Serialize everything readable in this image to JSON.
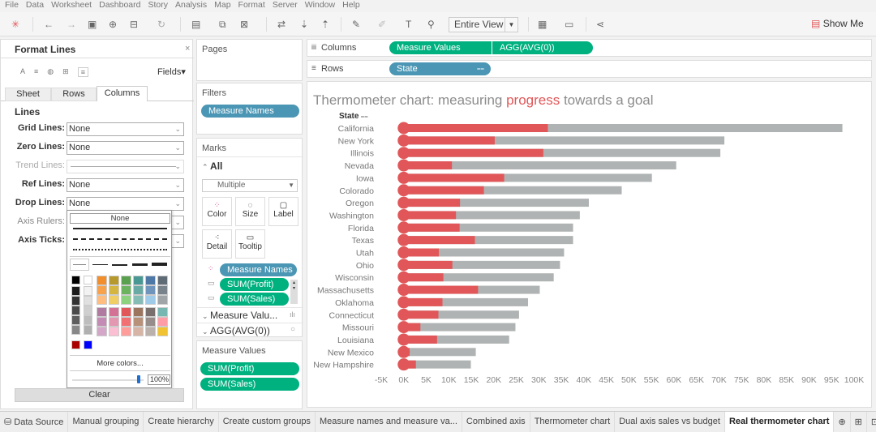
{
  "menu": [
    "File",
    "Data",
    "Worksheet",
    "Dashboard",
    "Story",
    "Analysis",
    "Map",
    "Format",
    "Server",
    "Window",
    "Help"
  ],
  "toolbar": {
    "view_select": "Entire View",
    "show_me": "Show Me"
  },
  "format_panel": {
    "title": "Format Lines",
    "close": "×",
    "fields": "Fields",
    "tabs": [
      "Sheet",
      "Rows",
      "Columns"
    ],
    "active_tab": "Columns",
    "section": "Lines",
    "rows": [
      {
        "label": "Grid Lines:",
        "value": "None"
      },
      {
        "label": "Zero Lines:",
        "value": "None"
      },
      {
        "label": "Trend Lines:",
        "value": ""
      },
      {
        "label": "Ref Lines:",
        "value": "None"
      },
      {
        "label": "Drop Lines:",
        "value": "None"
      },
      {
        "label": "Axis Rulers:",
        "value": ""
      },
      {
        "label": "Axis Ticks:",
        "value": ""
      }
    ],
    "popup": {
      "none": "None",
      "more_colors": "More colors...",
      "opacity": "100%",
      "opacity_value": 100
    },
    "clear": "Clear"
  },
  "pages": {
    "title": "Pages"
  },
  "filters": {
    "title": "Filters",
    "pills": [
      "Measure Names"
    ]
  },
  "marks": {
    "title": "Marks",
    "all": "All",
    "type": "Multiple",
    "cards": [
      "Color",
      "Size",
      "Label",
      "Detail",
      "Tooltip"
    ],
    "pills": [
      "Measure Names",
      "SUM(Profit)",
      "SUM(Sales)"
    ],
    "sections": [
      "Measure Valu...",
      "AGG(AVG(0))"
    ]
  },
  "measure_values": {
    "title": "Measure Values",
    "pills": [
      "SUM(Profit)",
      "SUM(Sales)"
    ]
  },
  "shelves": {
    "columns_label": "Columns",
    "columns": [
      "Measure Values",
      "AGG(AVG(0))"
    ],
    "rows_label": "Rows",
    "rows": [
      "State"
    ]
  },
  "chart_data": {
    "type": "bar",
    "title_parts": [
      "Thermometer chart: measuring ",
      "progress",
      " towards a goal"
    ],
    "ylabel": "State",
    "xlim": [
      -5000,
      100000
    ],
    "xticks": [
      "-5K",
      "0K",
      "5K",
      "10K",
      "15K",
      "20K",
      "25K",
      "30K",
      "35K",
      "40K",
      "45K",
      "50K",
      "55K",
      "60K",
      "65K",
      "70K",
      "75K",
      "80K",
      "85K",
      "90K",
      "95K",
      "100K"
    ],
    "categories": [
      "California",
      "New York",
      "Illinois",
      "Nevada",
      "Iowa",
      "Colorado",
      "Oregon",
      "Washington",
      "Florida",
      "Texas",
      "Utah",
      "Ohio",
      "Wisconsin",
      "Massachusetts",
      "Oklahoma",
      "Connecticut",
      "Missouri",
      "Louisiana",
      "New Mexico",
      "New Hampshire"
    ],
    "series": [
      {
        "name": "SUM(Sales)",
        "color": "#b0b3b3",
        "values": [
          97400,
          71200,
          70300,
          60500,
          55100,
          48400,
          41100,
          39100,
          37600,
          37600,
          35600,
          34700,
          33300,
          30200,
          27600,
          25600,
          24800,
          23400,
          16000,
          14900
        ]
      },
      {
        "name": "SUM(Profit)",
        "color": "#e15759",
        "values": [
          32000,
          20200,
          31000,
          10700,
          22300,
          17800,
          12500,
          11600,
          12400,
          15800,
          7800,
          10800,
          8800,
          16500,
          8600,
          7700,
          3700,
          7400,
          1300,
          2700
        ]
      }
    ],
    "colors": {
      "progress": "#e15759",
      "goal": "#b0b3b3",
      "title": "#8c8c8c"
    }
  },
  "sheet_tabs": [
    "Data Source",
    "Manual grouping",
    "Create hierarchy",
    "Create custom groups",
    "Measure names and measure va...",
    "Combined axis",
    "Thermometer chart",
    "Dual axis sales vs budget",
    "Real thermometer chart"
  ],
  "active_sheet": "Real thermometer chart"
}
